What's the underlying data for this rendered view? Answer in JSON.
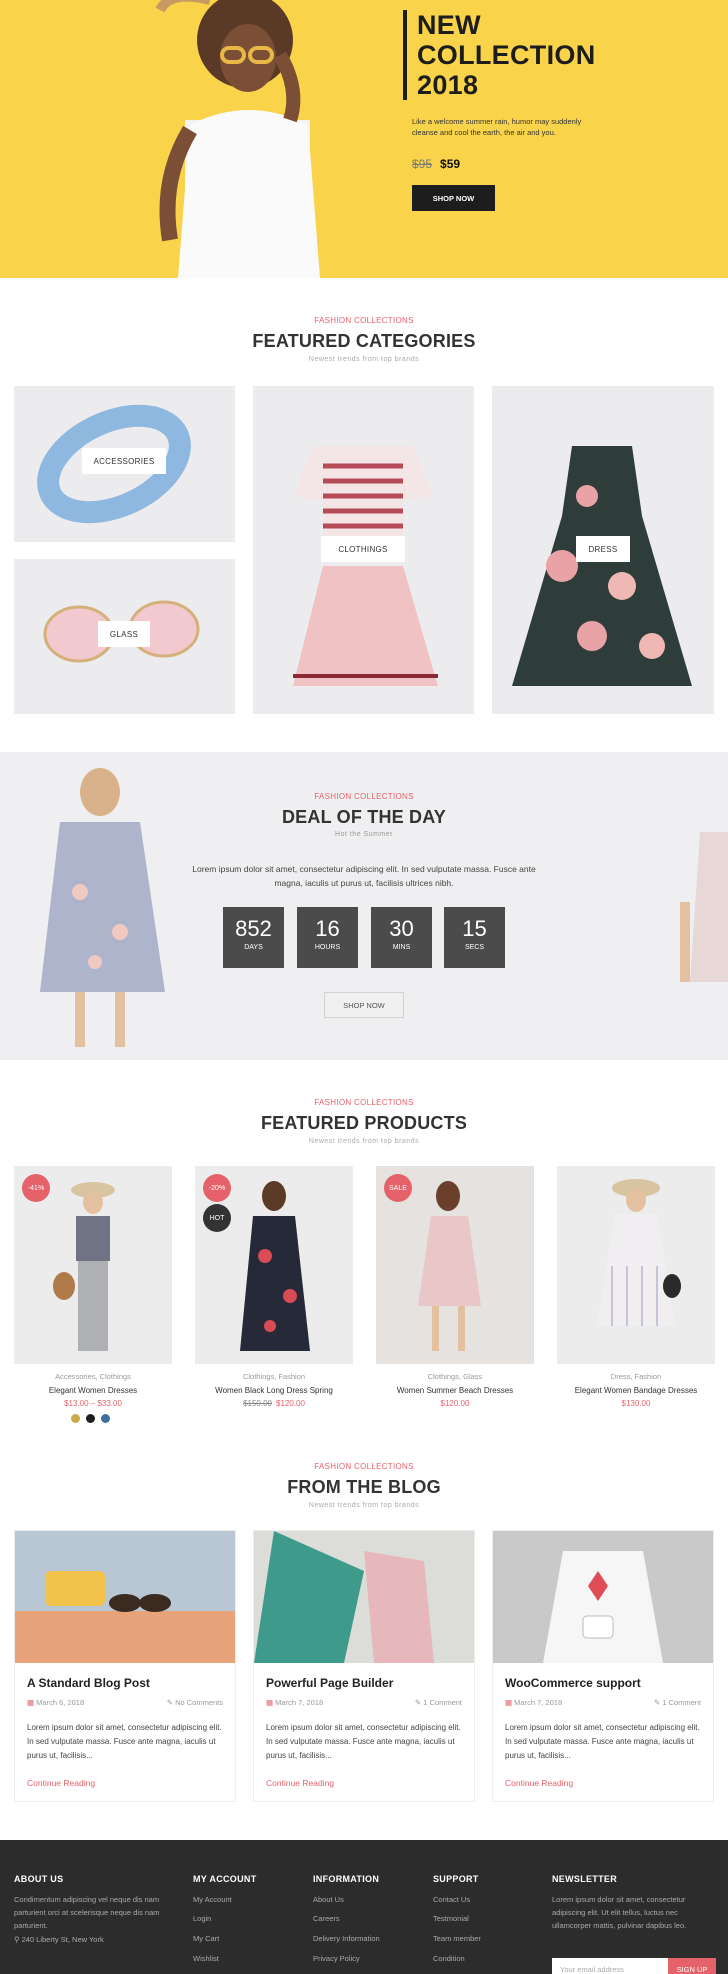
{
  "hero": {
    "title_line1": "NEW",
    "title_line2": "COLLECTION",
    "title_line3": "2018",
    "description": "Like a welcome summer rain, humor may suddenly cleanse and cool the earth, the air and you.",
    "old_price": "$95",
    "new_price": "$59",
    "button": "SHOP NOW",
    "bg_color": "#f9d44b"
  },
  "categories": {
    "kicker": "FASHION COLLECTIONS",
    "title": "FEATURED CATEGORIES",
    "subtitle": "Newest trends from top brands",
    "items": [
      {
        "label": "ACCESSORIES"
      },
      {
        "label": "GLASS"
      },
      {
        "label": "CLOTHINGS"
      },
      {
        "label": "DRESS"
      }
    ]
  },
  "deal": {
    "kicker": "FASHION COLLECTIONS",
    "title": "DEAL OF THE DAY",
    "subtitle": "Hot the Summer",
    "text": "Lorem ipsum dolor sit amet, consectetur adipiscing elit. In sed vulputate massa. Fusce ante magna, iaculis ut purus ut, facilisis ultrices nibh.",
    "countdown": [
      {
        "value": "852",
        "label": "DAYS"
      },
      {
        "value": "16",
        "label": "HOURS"
      },
      {
        "value": "30",
        "label": "MINS"
      },
      {
        "value": "15",
        "label": "SECS"
      }
    ],
    "button": "SHOP NOW"
  },
  "products": {
    "kicker": "FASHION COLLECTIONS",
    "title": "FEATURED PRODUCTS",
    "subtitle": "Newest trends from top brands",
    "items": [
      {
        "badge": "-41%",
        "categories": "Accessories, Clothings",
        "name": "Elegant Women Dresses",
        "price": "$13.00 – $33.00",
        "old_price": ""
      },
      {
        "badge": "-20%",
        "badge2": "HOT",
        "categories": "Clothings, Fashion",
        "name": "Women Black Long Dress Spring",
        "price": "$120.00",
        "old_price": "$150.00"
      },
      {
        "badge": "SALE",
        "categories": "Clothings, Glass",
        "name": "Women Summer Beach Dresses",
        "price": "$120.00",
        "old_price": ""
      },
      {
        "badge": "",
        "categories": "Dress, Fashion",
        "name": "Elegant Women Bandage Dresses",
        "price": "$130.00",
        "old_price": ""
      }
    ],
    "swatches": [
      "#c9a94a",
      "#1f1f1f",
      "#3b6fa0"
    ]
  },
  "blog": {
    "kicker": "FASHION COLLECTIONS",
    "title": "FROM THE BLOG",
    "subtitle": "Newest trends from top brands",
    "posts": [
      {
        "title": "A Standard Blog Post",
        "date": "March 6, 2018",
        "comments": "No Comments",
        "excerpt": "Lorem ipsum dolor sit amet, consectetur adipiscing elit. In sed vulputate massa. Fusce ante magna, iaculis ut purus ut, facilisis...",
        "link": "Continue Reading"
      },
      {
        "title": "Powerful Page Builder",
        "date": "March 7, 2018",
        "comments": "1 Comment",
        "excerpt": "Lorem ipsum dolor sit amet, consectetur adipiscing elit. In sed vulputate massa. Fusce ante magna, iaculis ut purus ut, facilisis...",
        "link": "Continue Reading"
      },
      {
        "title": "WooCommerce support",
        "date": "March 7, 2018",
        "comments": "1 Comment",
        "excerpt": "Lorem ipsum dolor sit amet, consectetur adipiscing elit. In sed vulputate massa. Fusce ante magna, iaculis ut purus ut, facilisis...",
        "link": "Continue Reading"
      }
    ]
  },
  "footer": {
    "about_title": "ABOUT US",
    "about_text": "Condimentum adipiscing vel neque dis nam parturient orci at scelerisque neque dis nam parturient.",
    "address": "240 Liberty St, New York",
    "account_title": "MY ACCOUNT",
    "account_links": [
      "My Account",
      "Login",
      "My Cart",
      "Wishlist"
    ],
    "info_title": "INFORMATION",
    "info_links": [
      "About Us",
      "Careers",
      "Delivery Information",
      "Privacy Policy"
    ],
    "support_title": "SUPPORT",
    "support_links": [
      "Contact Us",
      "Testmonial",
      "Team member",
      "Condition"
    ],
    "newsletter_title": "NEWSLETTER",
    "newsletter_text": "Lorem ipsum dolor sit amet, consectetur adipiscing elit. Ut elit tellus, luctus nec ullamcorper mattis, pulvinar dapibus leo.",
    "newsletter_placeholder": "Your email address",
    "newsletter_button": "SIGN UP"
  },
  "colors": {
    "accent": "#e5626b",
    "dark": "#2c2c2c",
    "hero_yellow": "#f9d44b"
  }
}
